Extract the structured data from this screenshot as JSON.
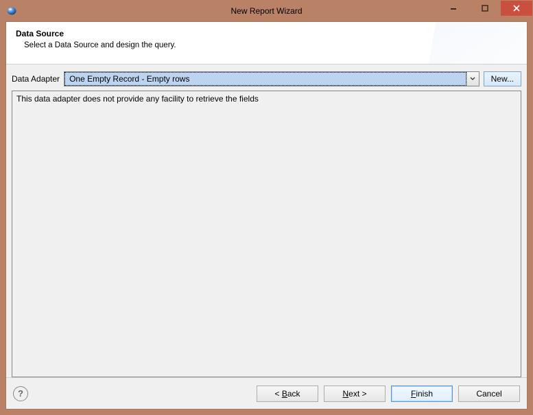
{
  "window": {
    "title": "New Report Wizard"
  },
  "header": {
    "title": "Data Source",
    "subtitle": "Select a Data Source and design the query."
  },
  "adapter": {
    "label": "Data Adapter",
    "selected": "One Empty Record - Empty rows",
    "new_label": "New..."
  },
  "fields": {
    "message": "This data adapter does not provide any facility to retrieve the fields"
  },
  "footer": {
    "back_prefix": "< ",
    "back_mnemonic": "B",
    "back_rest": "ack",
    "next_mnemonic": "N",
    "next_rest": "ext >",
    "finish_mnemonic": "F",
    "finish_rest": "inish",
    "cancel": "Cancel"
  }
}
